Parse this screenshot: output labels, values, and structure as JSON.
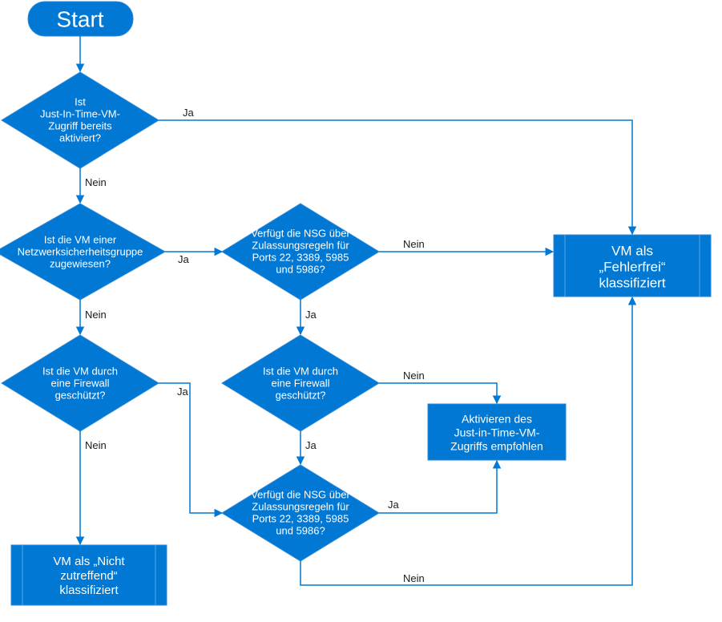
{
  "start": {
    "label": "Start"
  },
  "d1": {
    "l1": "Ist",
    "l2": "Just-In-Time-VM-",
    "l3": "Zugriff bereits",
    "l4": "aktiviert?"
  },
  "d2": {
    "l1": "Ist die VM einer",
    "l2": "Netzwerksicherheitsgruppe",
    "l3": "zugewiesen?"
  },
  "d3": {
    "l1": "Ist die VM durch",
    "l2": "eine Firewall",
    "l3": "geschützt?"
  },
  "d4": {
    "l1": "Verfügt die NSG über",
    "l2": "Zulassungsregeln für",
    "l3": "Ports 22, 3389, 5985",
    "l4": "und 5986?"
  },
  "d5": {
    "l1": "Ist die VM durch",
    "l2": "eine Firewall",
    "l3": "geschützt?"
  },
  "d6": {
    "l1": "Verfügt die NSG über",
    "l2": "Zulassungsregeln für",
    "l3": "Ports 22, 3389, 5985",
    "l4": "und 5986?"
  },
  "rNotApplicable": {
    "l1": "VM als „Nicht",
    "l2": "zutreffend“",
    "l3": "klassifiziert"
  },
  "rRecommend": {
    "l1": "Aktivieren des",
    "l2": "Just-in-Time-VM-",
    "l3": "Zugriffs empfohlen"
  },
  "rHealthy": {
    "l1": "VM als",
    "l2": "„Fehlerfrei“",
    "l3": "klassifiziert"
  },
  "labels": {
    "ja": "Ja",
    "nein": "Nein"
  }
}
